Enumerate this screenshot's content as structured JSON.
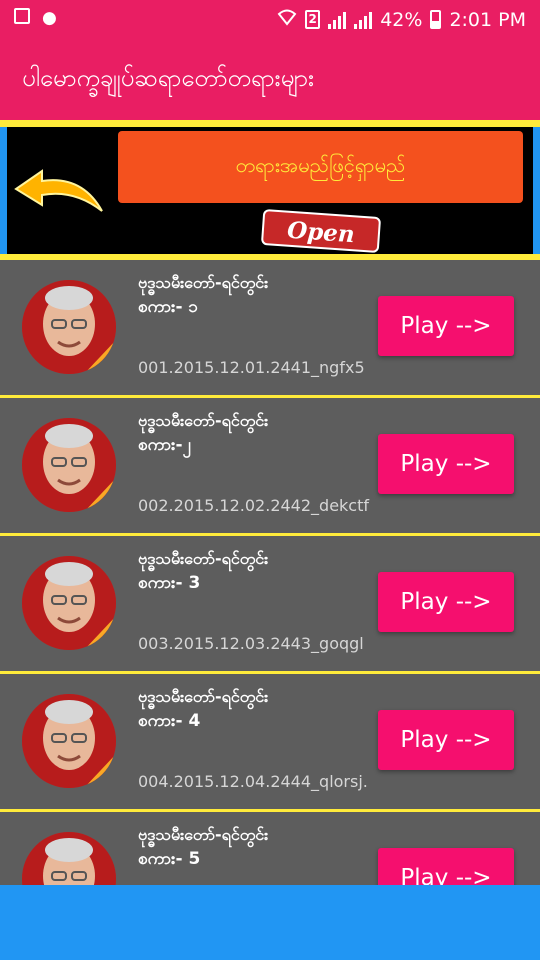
{
  "status": {
    "battery": "42%",
    "time": "2:01 PM",
    "sim_label": "2"
  },
  "appbar": {
    "title": "ပါမောက္ခချုပ်ဆရာတော်တရားများ"
  },
  "banner": {
    "search_label": "တရားအမည်ဖြင့်ရှာမည်",
    "open_label": "Open"
  },
  "items": [
    {
      "name": "ဗုဒ္ဓသမီးတော်-ရင်တွင်း",
      "part": "စကား- ၁",
      "file": "001.2015.12.01.2441_ngfx5",
      "play": "Play -->"
    },
    {
      "name": "ဗုဒ္ဓသမီးတော်-ရင်တွင်း",
      "part": "စကား-၂",
      "file": "002.2015.12.02.2442_dekctf",
      "play": "Play -->"
    },
    {
      "name": "ဗုဒ္ဓသမီးတော်-ရင်တွင်း",
      "part": "စကား- 3",
      "file": "003.2015.12.03.2443_goqgl",
      "play": "Play -->"
    },
    {
      "name": "ဗုဒ္ဓသမီးတော်-ရင်တွင်း",
      "part": "စကား- 4",
      "file": "004.2015.12.04.2444_qlorsj.",
      "play": "Play -->"
    },
    {
      "name": "ဗုဒ္ဓသမီးတော်-ရင်တွင်း",
      "part": "စကား- 5",
      "file": "",
      "play": "Play -->"
    }
  ],
  "colors": {
    "primary": "#e91e63",
    "accent_yellow": "#ffeb3b",
    "play_button": "#f50f6e",
    "bottom_bar": "#2196f3",
    "list_bg": "#5d5d5d"
  }
}
